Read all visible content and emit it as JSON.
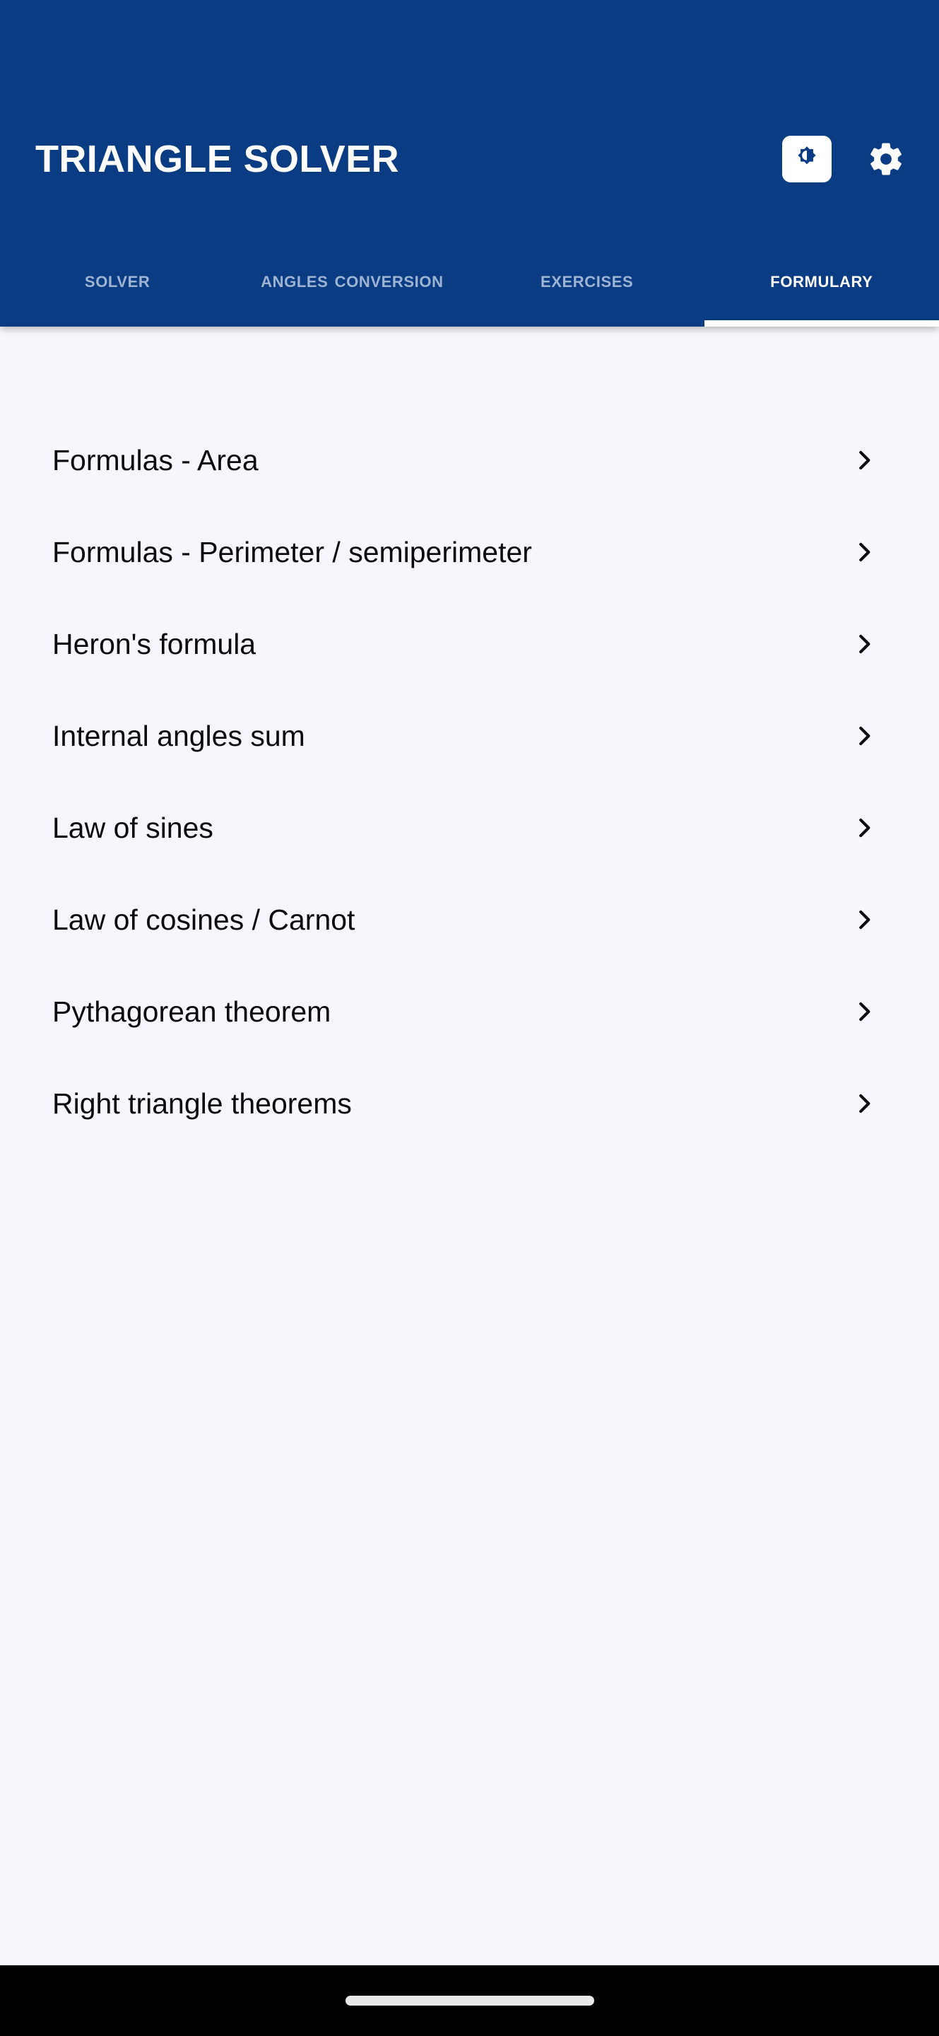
{
  "app": {
    "title": "TRIANGLE SOLVER",
    "brand_color": "#0A3C83",
    "content_bg": "#F7F6FC",
    "active_tab_color": "#FFFFFF",
    "inactive_tab_color": "#9FB4D2"
  },
  "appbar": {
    "theme_toggle_icon": "brightness-icon",
    "settings_icon": "gear-icon"
  },
  "tabs": [
    {
      "label": "Solver",
      "active": false
    },
    {
      "label": "Angles conversion",
      "active": false
    },
    {
      "label": "Exercises",
      "active": false
    },
    {
      "label": "Formulary",
      "active": true
    }
  ],
  "formulary": {
    "items": [
      {
        "label": "Formulas - Area",
        "chevron": "chevron-right-icon"
      },
      {
        "label": "Formulas - Perimeter / semiperimeter",
        "chevron": "chevron-right-icon"
      },
      {
        "label": "Heron's formula",
        "chevron": "chevron-right-icon"
      },
      {
        "label": "Internal angles sum",
        "chevron": "chevron-right-icon"
      },
      {
        "label": "Law of sines",
        "chevron": "chevron-right-icon"
      },
      {
        "label": "Law of cosines / Carnot",
        "chevron": "chevron-right-icon"
      },
      {
        "label": "Pythagorean theorem",
        "chevron": "chevron-right-icon"
      },
      {
        "label": "Right triangle theorems",
        "chevron": "chevron-right-icon"
      }
    ]
  },
  "system_nav": {
    "gesture_pill": "home-gesture-pill"
  }
}
